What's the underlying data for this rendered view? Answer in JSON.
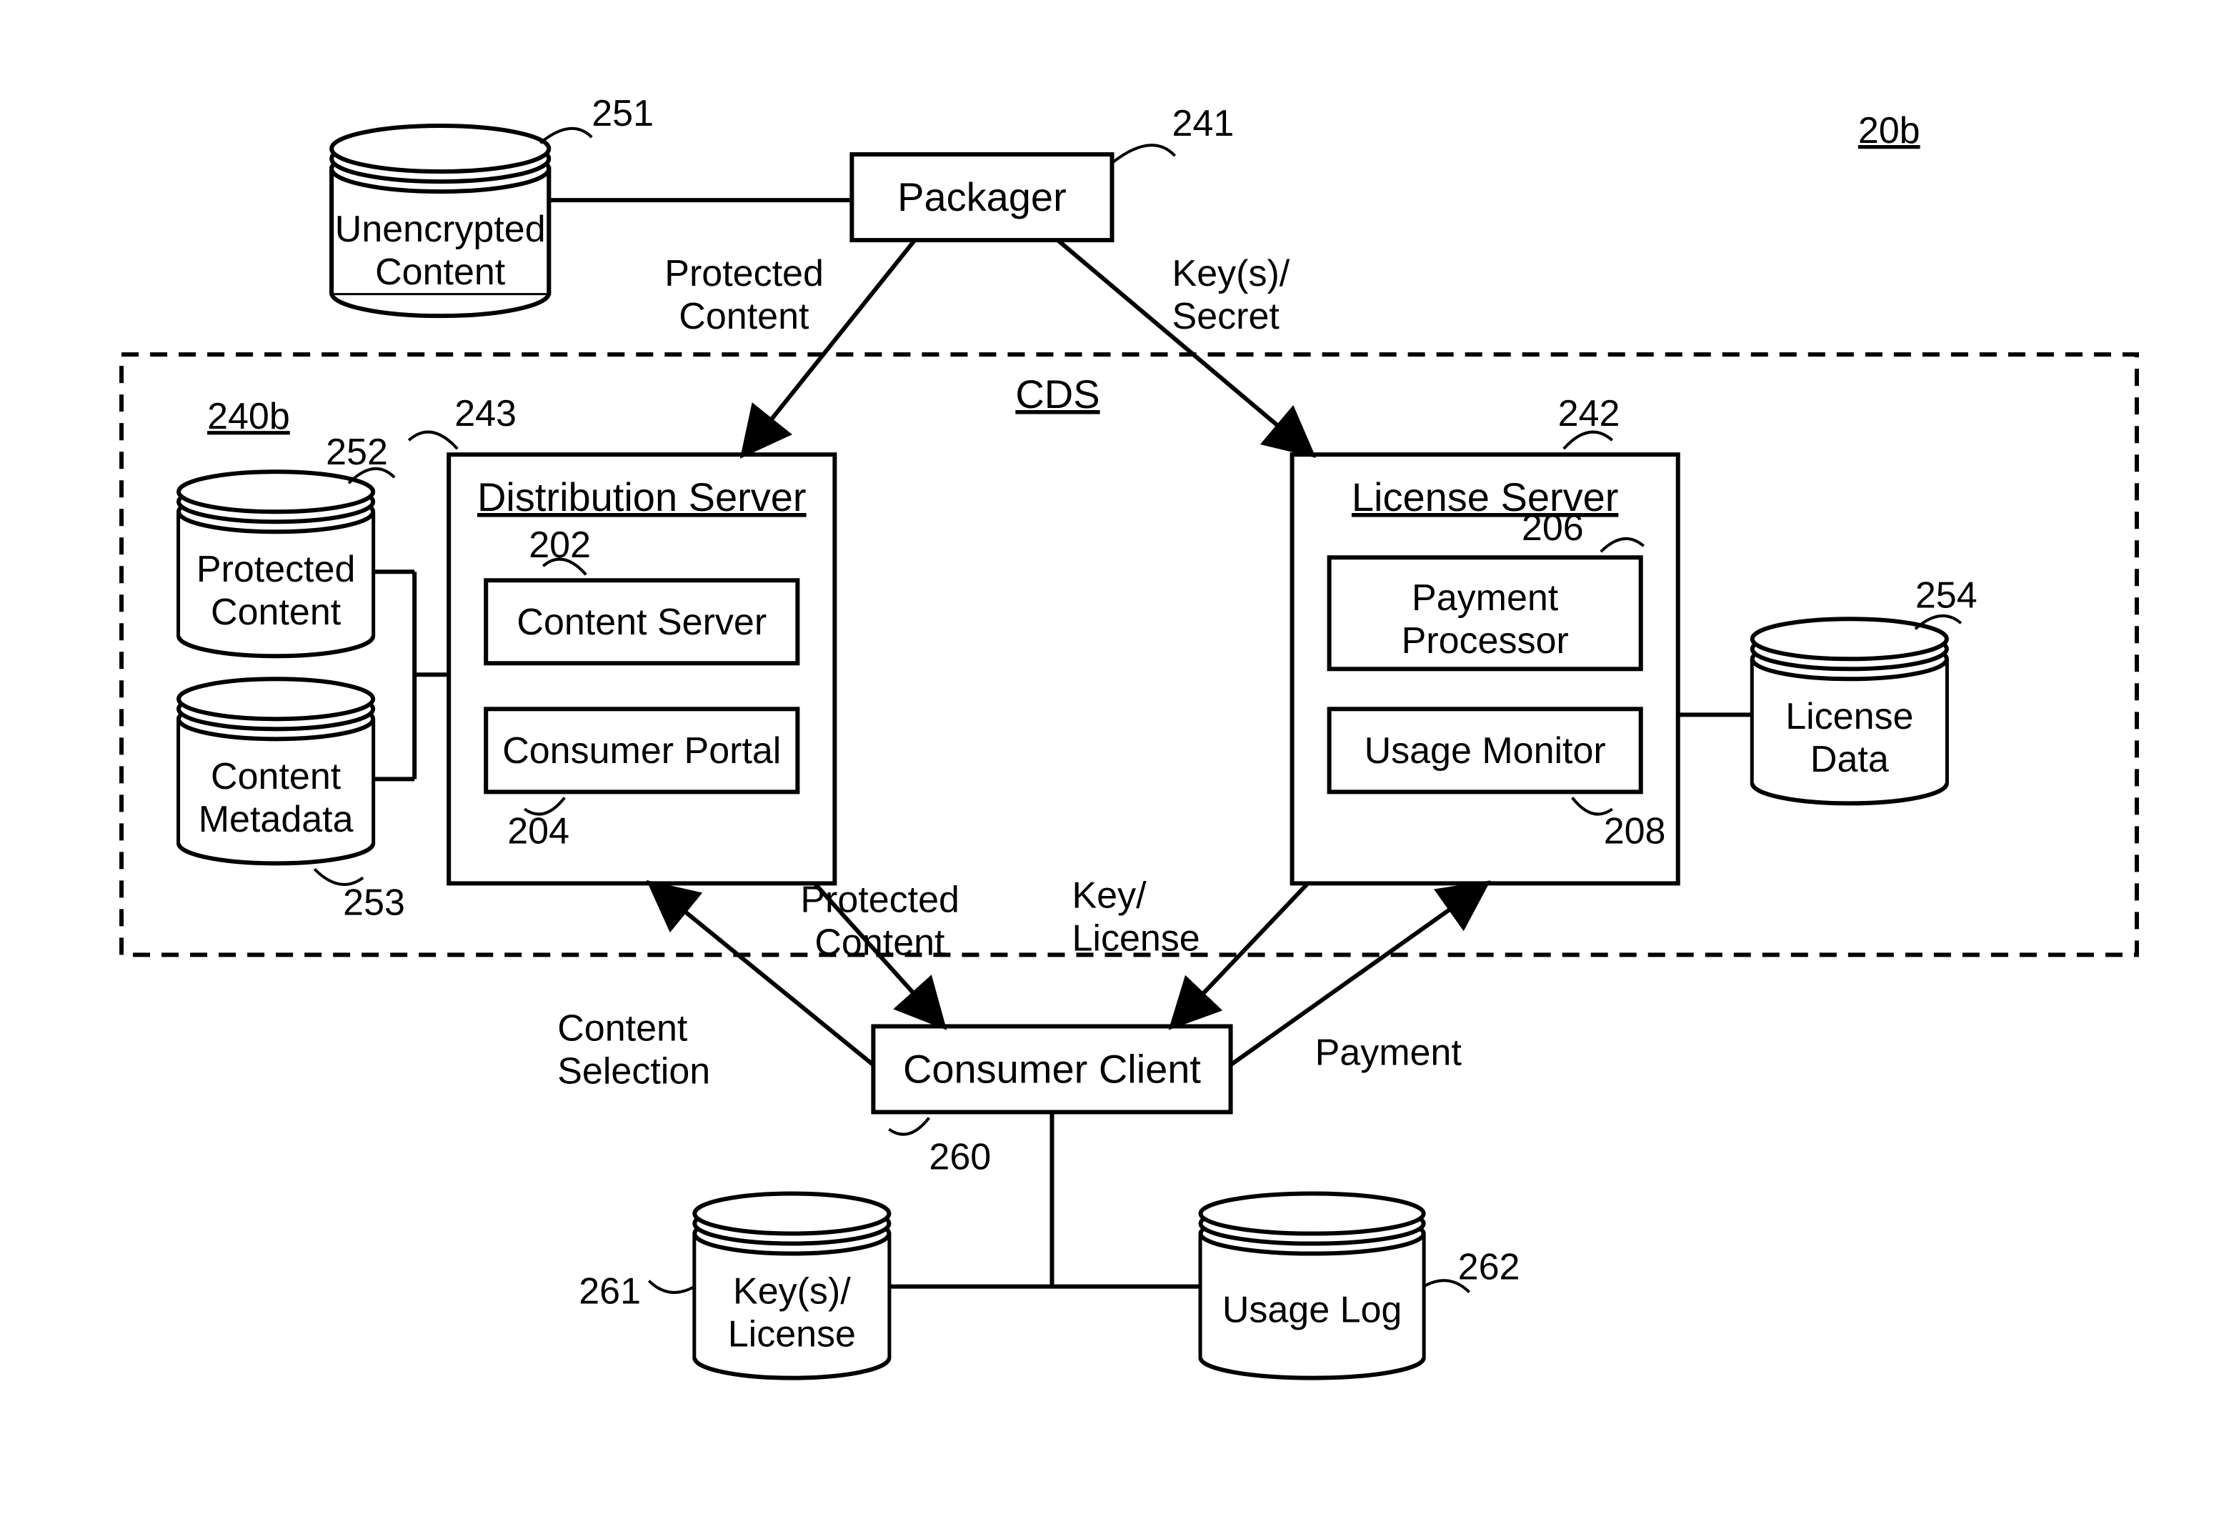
{
  "refs": {
    "figure": "20b",
    "cds": "240b",
    "packager": "241",
    "license_server": "242",
    "dist_server": "243",
    "unencrypted": "251",
    "protected_content_db": "252",
    "metadata_db": "253",
    "license_data": "254",
    "consumer_client": "260",
    "key_license_db": "261",
    "usage_log": "262",
    "content_server": "202",
    "consumer_portal": "204",
    "payment_proc": "206",
    "usage_monitor": "208"
  },
  "titles": {
    "cds": "CDS",
    "packager": "Packager",
    "dist_server": "Distribution Server",
    "license_server": "License Server",
    "content_server": "Content Server",
    "consumer_portal": "Consumer Portal",
    "payment_processor_l1": "Payment",
    "payment_processor_l2": "Processor",
    "usage_monitor": "Usage Monitor",
    "consumer_client": "Consumer Client"
  },
  "cylinders": {
    "unencrypted_l1": "Unencrypted",
    "unencrypted_l2": "Content",
    "protected_l1": "Protected",
    "protected_l2": "Content",
    "metadata_l1": "Content",
    "metadata_l2": "Metadata",
    "license_l1": "License",
    "license_l2": "Data",
    "keylic_l1": "Key(s)/",
    "keylic_l2": "License",
    "usage_log": "Usage Log"
  },
  "edges": {
    "protected_content_l1": "Protected",
    "protected_content_l2": "Content",
    "keys_secret_l1": "Key(s)/",
    "keys_secret_l2": "Secret",
    "protected_content2_l1": "Protected",
    "protected_content2_l2": "Content",
    "key_license_l1": "Key/",
    "key_license_l2": "License",
    "content_sel_l1": "Content",
    "content_sel_l2": "Selection",
    "payment": "Payment"
  }
}
